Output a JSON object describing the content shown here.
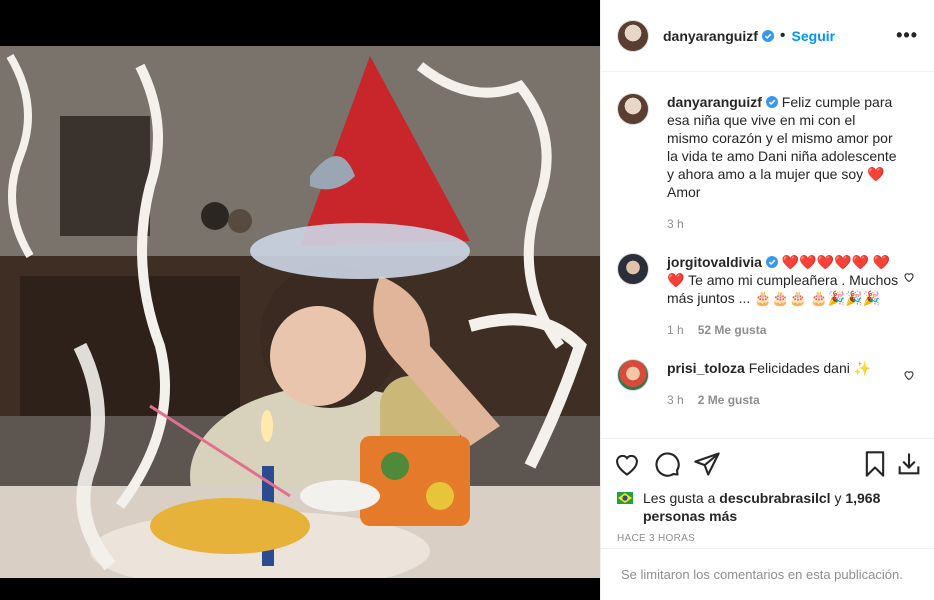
{
  "post": {
    "username": "danyaranguizf",
    "follow_label": "Seguir",
    "more_label": "•••",
    "caption": {
      "username": "danyaranguizf",
      "text": "Feliz cumple para esa niña que vive en mi con el mismo corazón y el mismo amor por la vida te amo Dani niña adolescente y ahora amo a la mujer que soy",
      "emoji": "❤️",
      "text_end": "Amor",
      "time": "3 h"
    },
    "comments": [
      {
        "username": "jorgitovaldivia",
        "hearts_line1": "❤️❤️❤️❤️❤️",
        "hearts_line2": "❤️❤️",
        "text": "Te amo mi cumpleañera . Muchos más juntos ...",
        "emoji_cake": "🎂🎂🎂",
        "emoji_party": "🎂🎉🎉🎉",
        "time": "1 h",
        "likes": "52 Me gusta"
      },
      {
        "username": "prisi_toloza",
        "text": "Felicidades dani",
        "emoji": "✨",
        "time": "3 h",
        "likes": "2 Me gusta"
      }
    ],
    "likes_prefix": "Les gusta a",
    "likes_user": "descubrabrasilcl",
    "likes_and": "y",
    "likes_count": "1,968 personas más",
    "posted_time": "HACE 3 HORAS",
    "comments_limited": "Se limitaron los comentarios en esta publicación."
  },
  "colors": {
    "accent": "#0095f6",
    "verified": "#3897f0",
    "muted": "#8e8e8e"
  }
}
